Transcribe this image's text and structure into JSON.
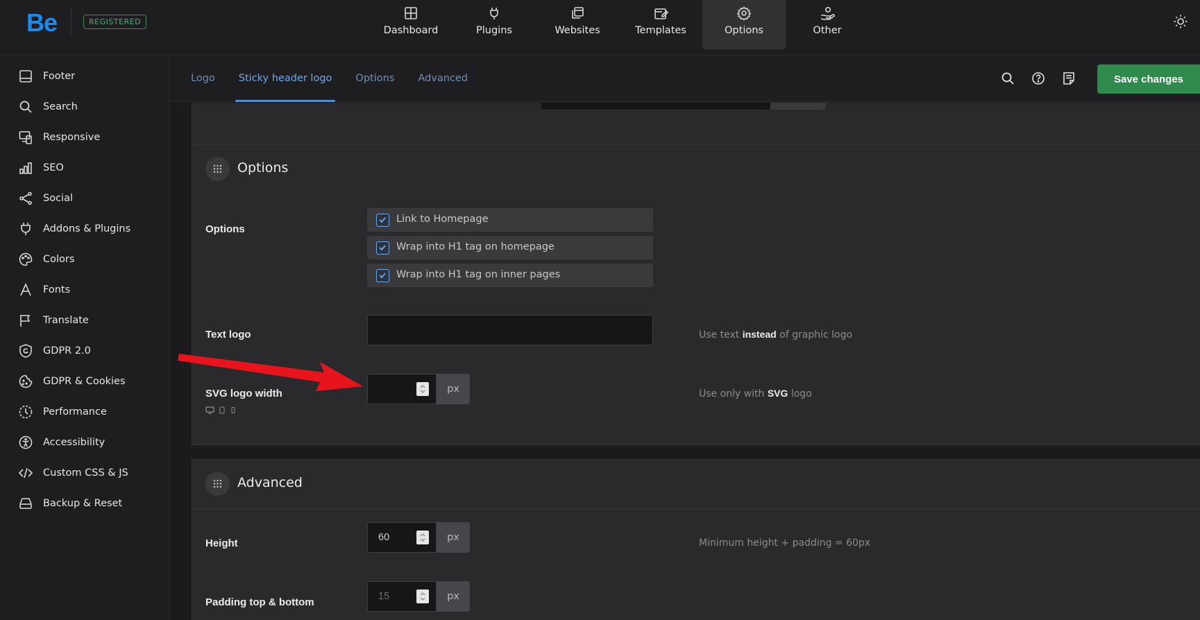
{
  "brand": {
    "logo_text": "Be",
    "badge": "REGISTERED"
  },
  "topnav": [
    {
      "label": "Dashboard",
      "icon": "dashboard-icon",
      "active": false
    },
    {
      "label": "Plugins",
      "icon": "plug-icon",
      "active": false
    },
    {
      "label": "Websites",
      "icon": "websites-icon",
      "active": false
    },
    {
      "label": "Templates",
      "icon": "templates-icon",
      "active": false
    },
    {
      "label": "Options",
      "icon": "gear-icon",
      "active": true
    },
    {
      "label": "Other",
      "icon": "hand-heart-icon",
      "active": false
    }
  ],
  "sidebar": {
    "items": [
      {
        "label": "Footer",
        "icon": "footer-icon"
      },
      {
        "label": "Search",
        "icon": "search-icon"
      },
      {
        "label": "Responsive",
        "icon": "responsive-icon"
      },
      {
        "label": "SEO",
        "icon": "seo-chart-icon"
      },
      {
        "label": "Social",
        "icon": "share-icon"
      },
      {
        "label": "Addons & Plugins",
        "icon": "plug-icon"
      },
      {
        "label": "Colors",
        "icon": "palette-icon"
      },
      {
        "label": "Fonts",
        "icon": "font-icon"
      },
      {
        "label": "Translate",
        "icon": "flag-icon"
      },
      {
        "label": "GDPR 2.0",
        "icon": "shield-icon"
      },
      {
        "label": "GDPR & Cookies",
        "icon": "cookie-icon"
      },
      {
        "label": "Performance",
        "icon": "timer-icon"
      },
      {
        "label": "Accessibility",
        "icon": "accessibility-icon"
      },
      {
        "label": "Custom CSS & JS",
        "icon": "code-icon"
      },
      {
        "label": "Backup & Reset",
        "icon": "drive-icon"
      }
    ]
  },
  "tabs": [
    {
      "label": "Logo",
      "active": false
    },
    {
      "label": "Sticky header logo",
      "active": true
    },
    {
      "label": "Options",
      "active": false
    },
    {
      "label": "Advanced",
      "active": false
    }
  ],
  "toolbar": {
    "save_label": "Save changes"
  },
  "options_section": {
    "title": "Options",
    "options_label": "Options",
    "checkboxes": [
      {
        "label": "Link to Homepage",
        "checked": true
      },
      {
        "label": "Wrap into H1 tag on homepage",
        "checked": true
      },
      {
        "label": "Wrap into H1 tag on inner pages",
        "checked": true
      }
    ],
    "text_logo": {
      "label": "Text logo",
      "value": "",
      "hint_prefix": "Use text ",
      "hint_bold": "instead",
      "hint_suffix": " of graphic logo"
    },
    "svg_width": {
      "label": "SVG logo width",
      "value": "",
      "unit": "px",
      "hint_prefix": "Use only with ",
      "hint_bold": "SVG",
      "hint_suffix": " logo"
    }
  },
  "advanced_section": {
    "title": "Advanced",
    "height": {
      "label": "Height",
      "value": "60",
      "unit": "px",
      "hint": "Minimum height + padding = 60px"
    },
    "padding": {
      "label": "Padding top & bottom",
      "value": "15",
      "unit": "px"
    }
  },
  "colors": {
    "accent": "#4f90d9",
    "save": "#2f8a4e",
    "brand": "#1a8cf0",
    "badge": "#4caf76",
    "arrow": "#e8141b"
  }
}
